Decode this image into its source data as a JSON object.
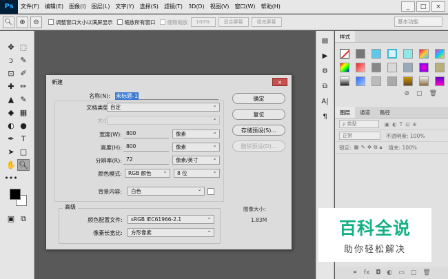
{
  "menubar": {
    "logo": "Ps",
    "items": [
      "文件(F)",
      "编辑(E)",
      "图像(I)",
      "图层(L)",
      "文字(Y)",
      "选择(S)",
      "滤镜(T)",
      "3D(D)",
      "视图(V)",
      "窗口(W)",
      "帮助(H)"
    ],
    "window_controls": [
      "_",
      "□",
      "×"
    ]
  },
  "options": {
    "check1": "调整窗口大小以满屏显示",
    "check2": "缩放所有窗口",
    "scrub": "细微缩放",
    "zoom_value": "100%",
    "fit_screen": "适合屏幕",
    "fill_screen": "填充屏幕",
    "workspace": "基本功能"
  },
  "tools": [
    [
      "✥",
      "⬚"
    ],
    [
      "ↄ",
      "✎"
    ],
    [
      "⊡",
      "✐"
    ],
    [
      "✚",
      "✏"
    ],
    [
      "▲",
      "✎"
    ],
    [
      "◆",
      "▦"
    ],
    [
      "◐",
      "●"
    ],
    [
      "✒",
      "T"
    ],
    [
      "➤",
      "□"
    ],
    [
      "✋",
      "🔍"
    ],
    [
      "•••",
      ""
    ]
  ],
  "dialog": {
    "title": "新建",
    "close": "×",
    "name_label": "名称(N):",
    "name_value": "未标题-1",
    "preset_label": "文档类型:",
    "preset_value": "自定",
    "size_label": "大小:",
    "width_label": "宽度(W):",
    "width_value": "800",
    "width_unit": "像素",
    "height_label": "高度(H):",
    "height_value": "800",
    "height_unit": "像素",
    "res_label": "分辨率(R):",
    "res_value": "72",
    "res_unit": "像素/英寸",
    "mode_label": "颜色模式:",
    "mode_value": "RGB 颜色",
    "bits_value": "8 位",
    "bg_label": "背景内容:",
    "bg_value": "白色",
    "advanced": "高级",
    "profile_label": "颜色配置文件:",
    "profile_value": "sRGB IEC61966-2.1",
    "aspect_label": "像素长宽比:",
    "aspect_value": "方形像素",
    "ok": "确定",
    "reset": "复位",
    "save_preset": "存储预设(S)...",
    "delete_preset": "删除预设(D)...",
    "img_size_label": "图像大小:",
    "img_size_value": "1.83M"
  },
  "styles_panel": {
    "tab": "样式"
  },
  "layers_panel": {
    "tabs": [
      "图层",
      "通道",
      "路径"
    ],
    "kind": "ρ 类型",
    "blend": "正常",
    "opacity": "不透明度: 100%",
    "lock": "锁定:",
    "fill": "填充: 100%"
  },
  "dock_icons": [
    "▤",
    "▶",
    "⚙",
    "⧉",
    "A|",
    "¶"
  ],
  "watermark": {
    "title": "百科全说",
    "subtitle": "助你轻松解决"
  }
}
